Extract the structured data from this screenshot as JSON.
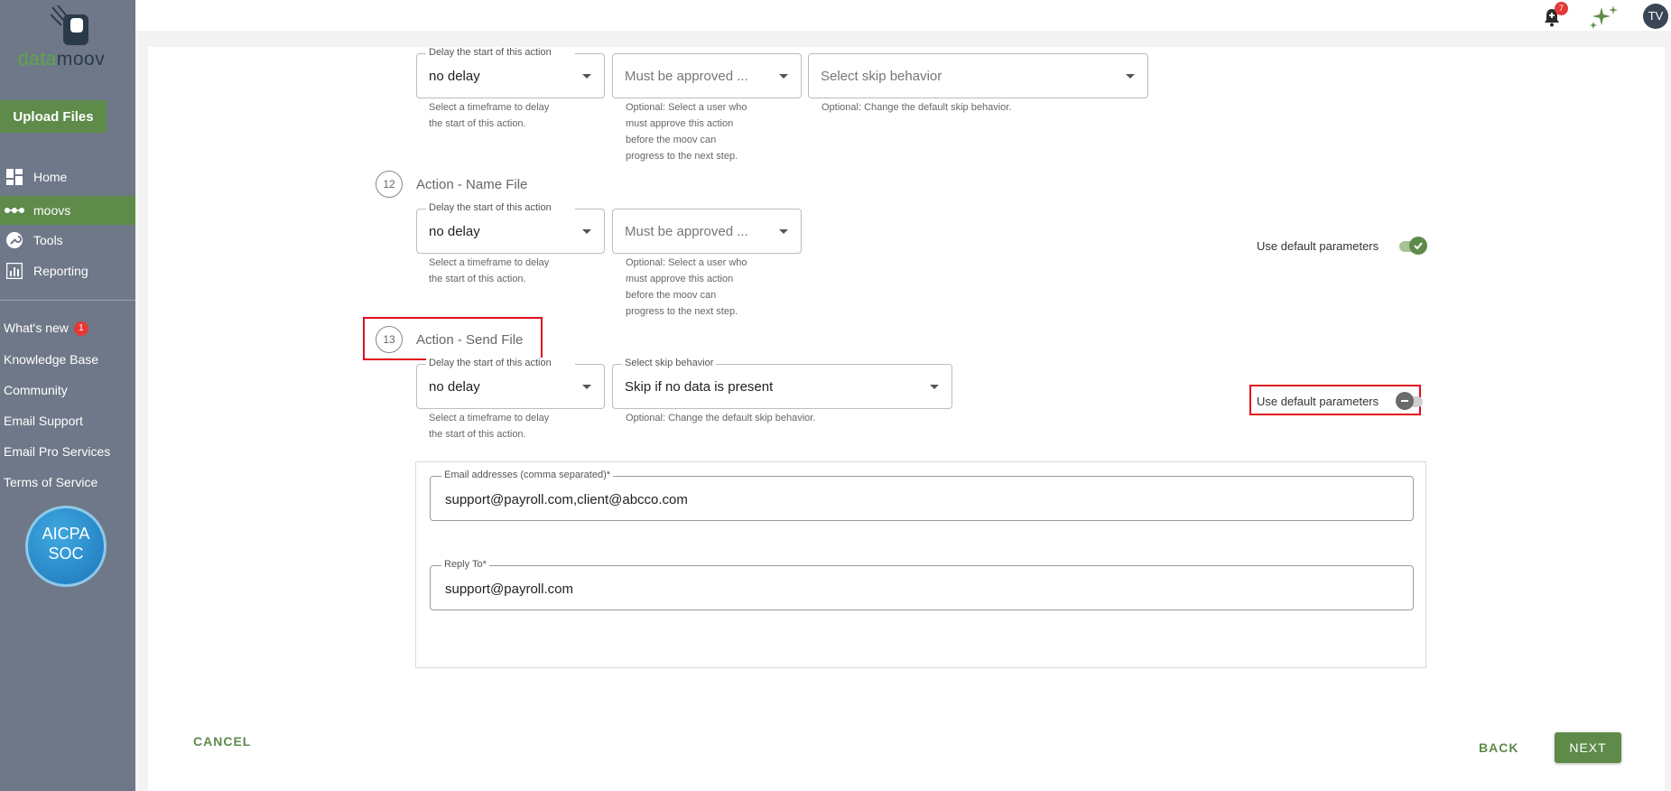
{
  "sidebar": {
    "logo_part1": "data",
    "logo_part2": "moov",
    "upload_label": "Upload Files",
    "nav": [
      {
        "label": "Home",
        "icon": "dashboard-icon"
      },
      {
        "label": "moovs",
        "icon": "workflow-icon"
      },
      {
        "label": "Tools",
        "icon": "wrench-icon"
      },
      {
        "label": "Reporting",
        "icon": "bar-chart-icon"
      }
    ],
    "links": [
      {
        "label": "What's new",
        "badge": "1"
      },
      {
        "label": "Knowledge Base"
      },
      {
        "label": "Community"
      },
      {
        "label": "Email Support"
      },
      {
        "label": "Email Pro Services"
      },
      {
        "label": "Terms of Service"
      }
    ],
    "soc": {
      "line1": "AICPA",
      "line2": "SOC"
    }
  },
  "topbar": {
    "notification_count": "7",
    "avatar_initials": "TV"
  },
  "steps": {
    "top": {
      "delay_label": "Delay the start of this action",
      "delay_value": "no delay",
      "delay_helper": [
        "Select a timeframe to delay",
        "the start of this action."
      ],
      "approval_placeholder": "Must be approved ...",
      "approval_helper": [
        "Optional: Select a user who",
        "must approve this action",
        "before the moov can",
        "progress to the next step."
      ],
      "skip_placeholder": "Select skip behavior",
      "skip_helper": "Optional: Change the default skip behavior."
    },
    "step12": {
      "number": "12",
      "title": "Action - Name File",
      "delay_label": "Delay the start of this action",
      "delay_value": "no delay",
      "delay_helper": [
        "Select a timeframe to delay",
        "the start of this action."
      ],
      "approval_placeholder": "Must be approved ...",
      "approval_helper": [
        "Optional: Select a user who",
        "must approve this action",
        "before the moov can",
        "progress to the next step."
      ],
      "toggle_label": "Use default parameters",
      "toggle_on": true
    },
    "step13": {
      "number": "13",
      "title": "Action - Send File",
      "delay_label": "Delay the start of this action",
      "delay_value": "no delay",
      "delay_helper": [
        "Select a timeframe to delay",
        "the start of this action."
      ],
      "skip_label": "Select skip behavior",
      "skip_value": "Skip if no data is present",
      "skip_helper": "Optional: Change the default skip behavior.",
      "toggle_label": "Use default parameters",
      "toggle_on": false,
      "email_label": "Email addresses (comma separated)*",
      "email_value": "support@payroll.com,client@abcco.com",
      "reply_label": "Reply To*",
      "reply_value": "support@payroll.com"
    }
  },
  "footer": {
    "cancel_label": "CANCEL",
    "back_label": "BACK",
    "next_label": "NEXT"
  },
  "colors": {
    "sidebar_bg": "#6f7888",
    "accent_green": "#5e8b4a",
    "highlight_red": "#e0101e",
    "badge_red": "#e53935"
  }
}
